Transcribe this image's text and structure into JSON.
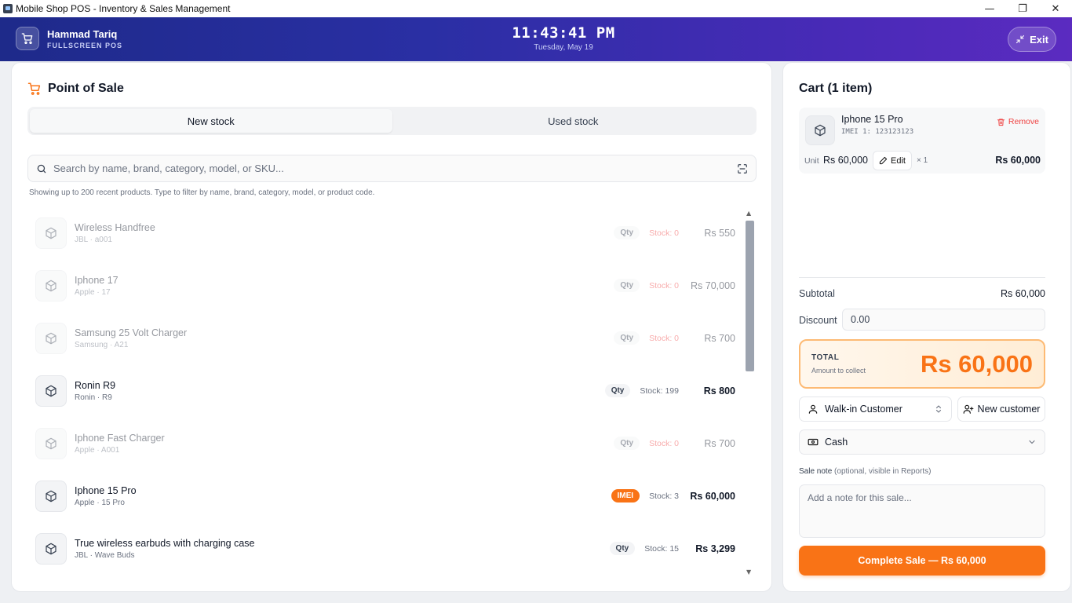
{
  "window": {
    "title": "Mobile Shop POS - Inventory & Sales Management",
    "minimize": "—",
    "maximize": "❐",
    "close": "✕"
  },
  "header": {
    "user_name": "Hammad Tariq",
    "mode": "FULLSCREEN POS",
    "time": "11:43:41 PM",
    "date": "Tuesday, May 19",
    "exit_label": "Exit"
  },
  "pos": {
    "title": "Point of Sale",
    "tabs": [
      {
        "label": "New stock",
        "active": true
      },
      {
        "label": "Used stock",
        "active": false
      }
    ],
    "search_placeholder": "Search by name, brand, category, model, or SKU...",
    "hint": "Showing up to 200 recent products. Type to filter by name, brand, category, model, or product code.",
    "products": [
      {
        "name": "Wireless Handfree",
        "sub": "JBL · a001",
        "badge": "Qty",
        "stock": "Stock: 0",
        "price": "Rs 550",
        "in_stock": false
      },
      {
        "name": "Iphone 17",
        "sub": "Apple · 17",
        "badge": "Qty",
        "stock": "Stock: 0",
        "price": "Rs 70,000",
        "in_stock": false
      },
      {
        "name": "Samsung 25 Volt Charger",
        "sub": "Samsung · A21",
        "badge": "Qty",
        "stock": "Stock: 0",
        "price": "Rs 700",
        "in_stock": false
      },
      {
        "name": "Ronin R9",
        "sub": "Ronin · R9",
        "badge": "Qty",
        "stock": "Stock: 199",
        "price": "Rs 800",
        "in_stock": true
      },
      {
        "name": "Iphone Fast Charger",
        "sub": "Apple · A001",
        "badge": "Qty",
        "stock": "Stock: 0",
        "price": "Rs 700",
        "in_stock": false
      },
      {
        "name": "Iphone 15 Pro",
        "sub": "Apple · 15 Pro",
        "badge": "IMEI",
        "stock": "Stock: 3",
        "price": "Rs 60,000",
        "in_stock": true
      },
      {
        "name": "True wireless earbuds with charging case",
        "sub": "JBL · Wave Buds",
        "badge": "Qty",
        "stock": "Stock: 15",
        "price": "Rs 3,299",
        "in_stock": true
      }
    ]
  },
  "cart": {
    "title": "Cart (1 item)",
    "item": {
      "name": "Iphone 15 Pro",
      "imei": "IMEI 1: 123123123",
      "remove_label": "Remove",
      "unit_label": "Unit",
      "unit_price": "Rs 60,000",
      "edit_label": "Edit",
      "quantity": "× 1",
      "line_total": "Rs 60,000"
    },
    "subtotal_label": "Subtotal",
    "subtotal_value": "Rs 60,000",
    "discount_label": "Discount",
    "discount_value": "0.00",
    "total_label": "TOTAL",
    "total_sub": "Amount to collect",
    "total_value": "Rs 60,000",
    "customer": "Walk-in Customer",
    "new_customer_label": "New customer",
    "payment_method": "Cash",
    "note_label": "Sale note",
    "note_hint": "(optional, visible in Reports)",
    "note_placeholder": "Add a note for this sale...",
    "complete_label": "Complete Sale — Rs 60,000"
  },
  "colors": {
    "accent": "#f97316",
    "header_start": "#1e2a8a",
    "header_end": "#5b2bc0",
    "danger": "#ef4444"
  }
}
